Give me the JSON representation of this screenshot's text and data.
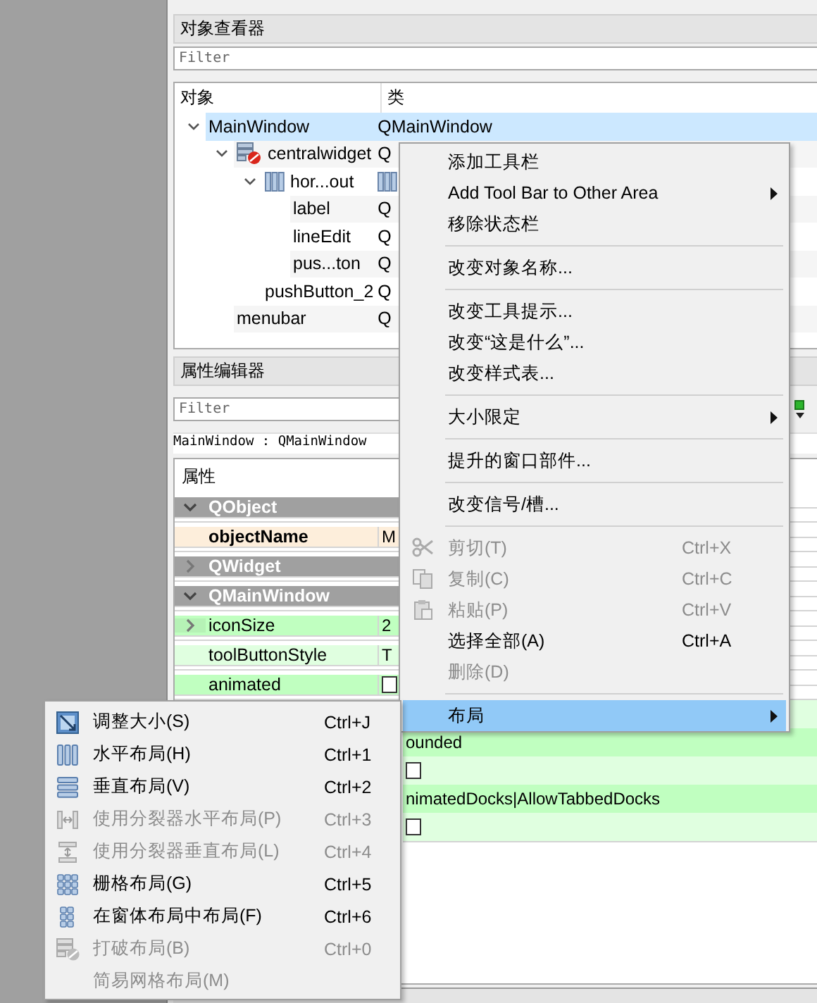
{
  "object_inspector": {
    "title": "对象查看器",
    "filter_placeholder": "Filter",
    "columns": [
      "对象",
      "类"
    ],
    "tree": [
      {
        "name": "MainWindow",
        "class": "QMainWindow",
        "expanded": true,
        "selected": true,
        "children": [
          {
            "name": "centralwidget",
            "class": "Q",
            "kind": "widget",
            "expanded": true,
            "selected": false,
            "children": [
              {
                "name": "hor...out",
                "kind": "layout",
                "expanded": true,
                "selected": false,
                "children": [
                  {
                    "name": "label",
                    "class": "Q",
                    "selected": false
                  },
                  {
                    "name": "lineEdit",
                    "class": "Q",
                    "selected": false
                  },
                  {
                    "name": "pus...ton",
                    "class": "Q",
                    "selected": false
                  }
                ]
              },
              {
                "name": "pushButton_2",
                "class": "Q",
                "selected": false
              }
            ]
          },
          {
            "name": "menubar",
            "class": "Q",
            "selected": false
          }
        ]
      }
    ]
  },
  "property_editor": {
    "title": "属性编辑器",
    "filter_placeholder": "Filter",
    "object_label": "MainWindow : QMainWindow",
    "columns": [
      "属性"
    ],
    "rows": [
      {
        "kind": "group",
        "name": "QObject",
        "expanded": true
      },
      {
        "kind": "text",
        "name": "objectName",
        "value": "M",
        "bold": true,
        "color": "#fdeedb"
      },
      {
        "kind": "group",
        "name": "QWidget",
        "expanded": false
      },
      {
        "kind": "group",
        "name": "QMainWindow",
        "expanded": true
      },
      {
        "kind": "text",
        "name": "iconSize",
        "value": "2",
        "expanded": false,
        "color": "#c0ffc0"
      },
      {
        "kind": "text",
        "name": "toolButtonStyle",
        "value": "T",
        "color": "#e0ffe0"
      },
      {
        "kind": "checkbox",
        "name": "animated",
        "checked": false,
        "color": "#c0ffc0"
      },
      {
        "kind": "text",
        "color": "#e0ffe0"
      },
      {
        "kind": "text",
        "value": "ounded",
        "color": "#c0ffc0"
      },
      {
        "kind": "checkbox",
        "checked": false,
        "color": "#e0ffe0"
      },
      {
        "kind": "text",
        "value": "nimatedDocks|AllowTabbedDocks",
        "color": "#c0ffc0"
      },
      {
        "kind": "checkbox",
        "checked": false,
        "color": "#e0ffe0"
      }
    ]
  },
  "context_menu": [
    {
      "kind": "item",
      "label": "添加工具栏",
      "submenu": false,
      "disabled": false,
      "selected": false
    },
    {
      "kind": "item",
      "label": "Add Tool Bar to Other Area",
      "submenu": true,
      "disabled": false,
      "selected": false
    },
    {
      "kind": "item",
      "label": "移除状态栏",
      "submenu": false,
      "disabled": false,
      "selected": false
    },
    {
      "kind": "separator"
    },
    {
      "kind": "item",
      "label": "改变对象名称...",
      "submenu": false,
      "disabled": false,
      "selected": false
    },
    {
      "kind": "separator"
    },
    {
      "kind": "item",
      "label": "改变工具提示...",
      "submenu": false,
      "disabled": false,
      "selected": false
    },
    {
      "kind": "item",
      "label": "改变“这是什么”...",
      "submenu": false,
      "disabled": false,
      "selected": false
    },
    {
      "kind": "item",
      "label": "改变样式表...",
      "submenu": false,
      "disabled": false,
      "selected": false
    },
    {
      "kind": "separator"
    },
    {
      "kind": "item",
      "label": "大小限定",
      "submenu": true,
      "disabled": false,
      "selected": false
    },
    {
      "kind": "separator"
    },
    {
      "kind": "item",
      "label": "提升的窗口部件...",
      "submenu": false,
      "disabled": false,
      "selected": false
    },
    {
      "kind": "separator"
    },
    {
      "kind": "item",
      "label": "改变信号/槽...",
      "submenu": false,
      "disabled": false,
      "selected": false
    },
    {
      "kind": "separator"
    },
    {
      "kind": "item",
      "label": "剪切(T)",
      "shortcut": "Ctrl+X",
      "submenu": false,
      "disabled": true,
      "selected": false
    },
    {
      "kind": "item",
      "label": "复制(C)",
      "shortcut": "Ctrl+C",
      "submenu": false,
      "disabled": true,
      "selected": false
    },
    {
      "kind": "item",
      "label": "粘贴(P)",
      "shortcut": "Ctrl+V",
      "submenu": false,
      "disabled": true,
      "selected": false
    },
    {
      "kind": "item",
      "label": "选择全部(A)",
      "shortcut": "Ctrl+A",
      "submenu": false,
      "disabled": false,
      "selected": false
    },
    {
      "kind": "item",
      "label": "删除(D)",
      "submenu": false,
      "disabled": true,
      "selected": false
    },
    {
      "kind": "separator"
    },
    {
      "kind": "item",
      "label": "布局",
      "submenu": true,
      "disabled": false,
      "selected": true
    }
  ],
  "layout_submenu": [
    {
      "label": "调整大小(S)",
      "shortcut": "Ctrl+J",
      "disabled": false
    },
    {
      "label": "水平布局(H)",
      "shortcut": "Ctrl+1",
      "disabled": false
    },
    {
      "label": "垂直布局(V)",
      "shortcut": "Ctrl+2",
      "disabled": false
    },
    {
      "label": "使用分裂器水平布局(P)",
      "shortcut": "Ctrl+3",
      "disabled": true
    },
    {
      "label": "使用分裂器垂直布局(L)",
      "shortcut": "Ctrl+4",
      "disabled": true
    },
    {
      "label": "栅格布局(G)",
      "shortcut": "Ctrl+5",
      "disabled": false
    },
    {
      "label": "在窗体布局中布局(F)",
      "shortcut": "Ctrl+6",
      "disabled": false
    },
    {
      "label": "打破布局(B)",
      "shortcut": "Ctrl+0",
      "disabled": true
    },
    {
      "label": "简易网格布局(M)",
      "disabled": true
    }
  ]
}
